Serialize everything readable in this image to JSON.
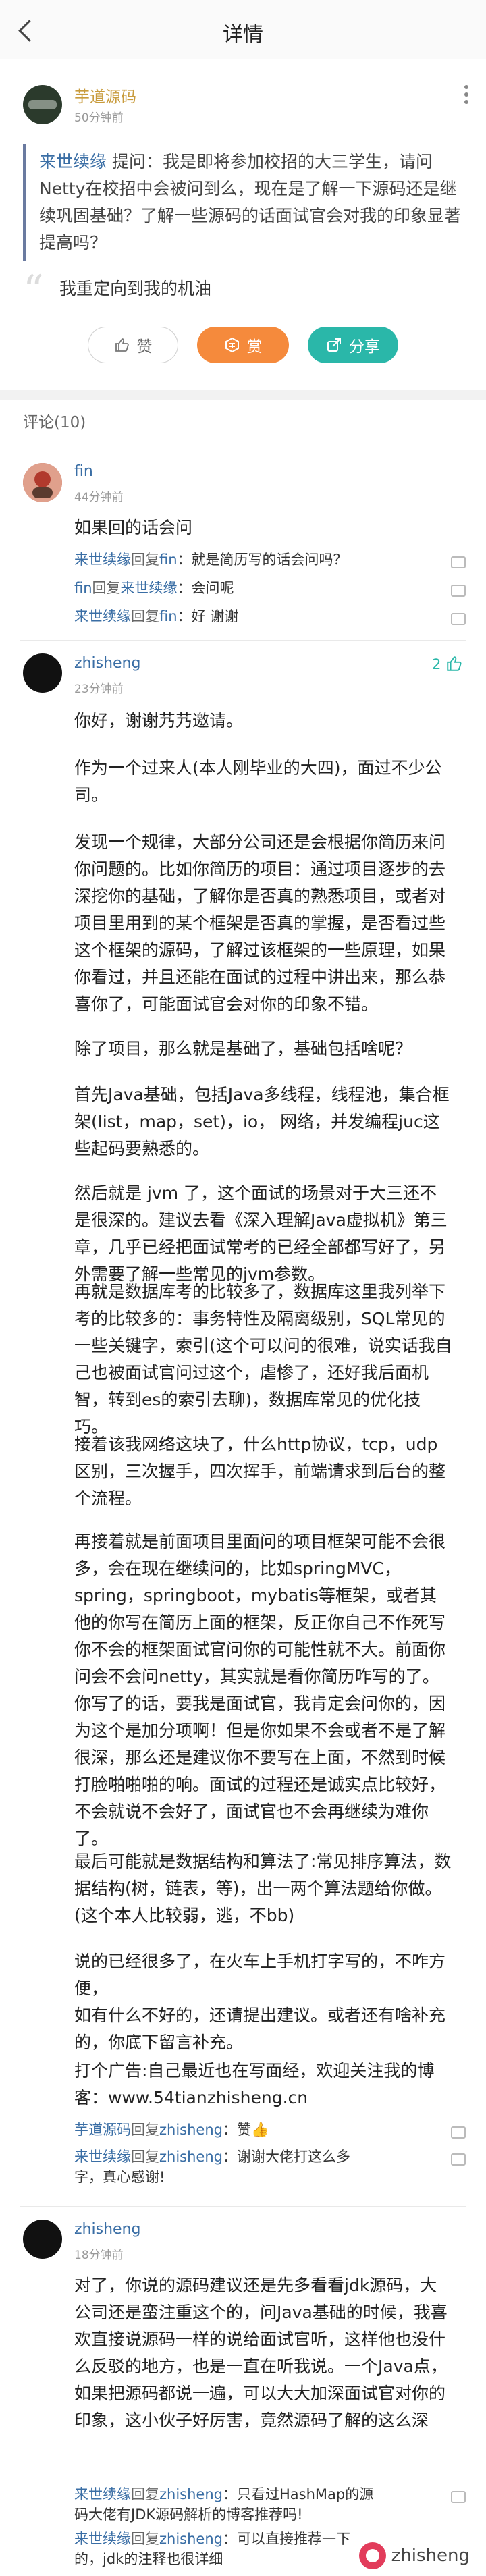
{
  "header": {
    "title": "详情"
  },
  "post": {
    "author": "芋道源码",
    "time": "50分钟前",
    "quote_user": "来世续缘",
    "quote_text": " 提问：我是即将参加校招的大三学生，请问Netty在校招中会被问到么，现在是了解一下源码还是继续巩固基础？了解一些源码的话面试官会对我的印象显著提高吗？",
    "answer": "我重定向到我的机油",
    "buttons": {
      "like": "赞",
      "reward": "赏",
      "share": "分享"
    }
  },
  "comments_title": "评论(10)",
  "comments": [
    {
      "user": "fin",
      "time": "44分钟前",
      "body": "如果回的话会问",
      "replies": [
        {
          "from": "来世续缘",
          "to": "fin",
          "text": "就是简历写的话会问吗？"
        },
        {
          "from": "fin",
          "to": "来世续缘",
          "text": "会问呢"
        },
        {
          "from": "来世续缘",
          "to": "fin",
          "text": "好  谢谢"
        }
      ]
    },
    {
      "user": "zhisheng",
      "time": "23分钟前",
      "like_count": "2",
      "paragraphs": [
        "你好，谢谢艿艿邀请。",
        "作为一个过来人(本人刚毕业的大四)，面过不少公司。",
        "发现一个规律，大部分公司还是会根据你简历来问你问题的。比如你简历的项目：通过项目逐步的去深挖你的基础，了解你是否真的熟悉项目，或者对项目里用到的某个框架是否真的掌握，是否看过些这个框架的源码，了解过该框架的一些原理，如果你看过，并且还能在面试的过程中讲出来，那么恭喜你了，可能面试官会对你的印象不错。",
        "除了项目，那么就是基础了，基础包括啥呢？",
        "首先Java基础，包括Java多线程，线程池，集合框架(list，map，set)，io，  网络，并发编程juc这些起码要熟悉的。",
        "然后就是  jvm  了，这个面试的场景对于大三还不是很深的。建议去看《深入理解Java虚拟机》第三章，几乎已经把面试常考的已经全部都写好了，另外需要了解一些常见的jvm参数。",
        "再就是数据库考的比较多了，数据库这里我列举下考的比较多的：事务特性及隔离级别，SQL常见的一些关键字，索引(这个可以问的很难，说实话我自己也被面试官问过这个，虐惨了，还好我后面机智，转到es的索引去聊)，数据库常见的优化技巧。",
        "接着该我网络这块了，什么http协议，tcp，udp区别，三次握手，四次挥手，前端请求到后台的整个流程。",
        "再接着就是前面项目里面问的项目框架可能不会很多，会在现在继续问的，比如springMVC，spring，springboot，mybatis等框架，或者其他的你写在简历上面的框架，反正你自己不作死写你不会的框架面试官问你的可能性就不大。前面你问会不会问netty，其实就是看你简历咋写的了。你写了的话，要我是面试官，我肯定会问你的，因为这个是加分项啊！但是你如果不会或者不是了解很深，那么还是建议你不要写在上面，不然到时候打脸啪啪啪的响。面试的过程还是诚实点比较好，不会就说不会好了，面试官也不会再继续为难你了。",
        "最后可能就是数据结构和算法了:常见排序算法，数据结构(树，链表，等)，出一两个算法题给你做。(这个本人比较弱，逃，不bb)",
        "说的已经很多了，在火车上手机打字写的，不咋方便，\n如有什么不好的，还请提出建议。或者还有啥补充的，你底下留言补充。",
        "打个广告:自己最近也在写面经，欢迎关注我的博客：www.54tianzhisheng.cn"
      ],
      "replies": [
        {
          "from": "芋道源码",
          "to": "zhisheng",
          "text": "赞👍"
        },
        {
          "from": "来世续缘",
          "to": "zhisheng",
          "text": "谢谢大佬打这么多字，真心感谢!"
        }
      ]
    },
    {
      "user": "zhisheng",
      "time": "18分钟前",
      "body": "对了，你说的源码建议还是先多看看jdk源码，大公司还是蛮注重这个的，问Java基础的时候，我喜欢直接说源码一样的说给面试官听，这样他也没什么反驳的地方，也是一直在听我说。一个Java点，如果把源码都说一遍，可以大大加深面试官对你的印象，这小伙子好厉害，竟然源码了解的这么深",
      "replies": [
        {
          "from": "来世续缘",
          "to": "zhisheng",
          "text": "只看过HashMap的源码大佬有JDK源码解析的博客推荐吗!"
        },
        {
          "from": "来世续缘",
          "to": "zhisheng",
          "text": "可以直接推荐一下的，jdk的注释也很详细"
        }
      ]
    }
  ],
  "watermark": "zhisheng",
  "reply_word": "回复"
}
